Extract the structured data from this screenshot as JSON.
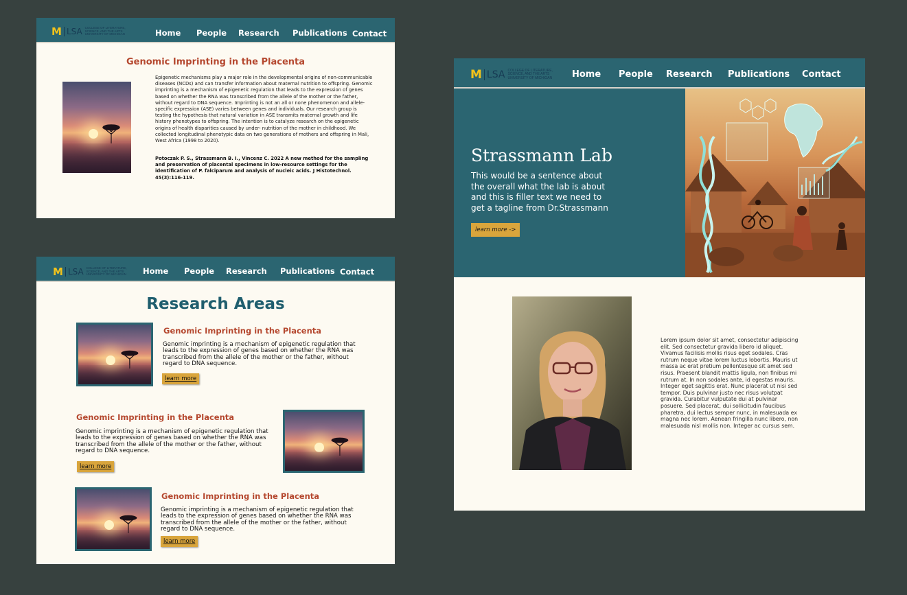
{
  "logo": {
    "mark": "M",
    "lsa": "LSA",
    "line1": "COLLEGE OF LITERATURE,",
    "line2": "SCIENCE, AND THE ARTS",
    "line3": "UNIVERSITY OF MICHIGAN"
  },
  "nav": {
    "home": "Home",
    "people": "People",
    "research": "Research",
    "publications": "Publications",
    "contact": "Contact"
  },
  "detail_page": {
    "title": "Genomic Imprinting in the Placenta",
    "body": "Epigenetic mechanisms play a major role in the developmental origins of non-communicable diseases (NCDs) and can transfer information about maternal nutrition to offspring. Genomic imprinting is a mechanism of epigenetic regulation that leads to the expression of genes based on whether the RNA was transcribed from the allele of the mother or the father, without regard to DNA sequence. Imprinting is not an all or none phenomenon and allele-specific expression (ASE) varies between genes and individuals. Our research group is testing the hypothesis that natural variation in ASE transmits maternal growth and life history phenotypes to offspring. The intention is to catalyze research on the epigenetic origins of health disparities caused by under- nutrition of the mother in childhood. We collected longitudinal phenotypic data on two generations of mothers and offspring in Mali, West Africa (1998 to 2020).",
    "reference": "Potoczak P. S., Strassmann B. I., Vincenz C. 2022 A new method for the sampling and preservation of placental specimens in low-resource settings for the identification of P. falciparum and analysis of nucleic acids. J Histotechnol. 45(3):116-119."
  },
  "areas_page": {
    "title": "Research Areas",
    "cards": [
      {
        "title": "Genomic Imprinting in the Placenta",
        "text": "Genomic imprinting is a mechanism of epigenetic regulation that leads to the expression of genes based on whether the RNA was transcribed from the allele of the mother or the father, without regard to DNA sequence.",
        "button": "learn more"
      },
      {
        "title": "Genomic Imprinting in the Placenta",
        "text": "Genomic imprinting is a mechanism of epigenetic regulation that leads to the expression of genes based on whether the RNA was transcribed from the allele of the mother or the father, without regard to DNA sequence.",
        "button": "learn more"
      },
      {
        "title": "Genomic Imprinting in the Placenta",
        "text": "Genomic imprinting is a mechanism of epigenetic regulation that leads to the expression of genes based on whether the RNA was transcribed from the allele of the mother or the father, without regard to DNA sequence.",
        "button": "learn more"
      }
    ]
  },
  "home_page": {
    "title": "Strassmann Lab",
    "tagline": "This would be a sentence about the overall what the lab is about and this is filler text we need to get a tagline from Dr.Strassmann",
    "button": "learn more ->",
    "bio": "Lorem ipsum dolor sit amet, consectetur adipiscing elit. Sed consectetur gravida libero id aliquet. Vivamus facilisis mollis risus eget sodales. Cras rutrum neque vitae lorem luctus lobortis. Mauris ut massa ac erat pretium pellentesque sit amet sed risus. Praesent blandit mattis ligula, non finibus mi rutrum at. In non sodales ante, id egestas mauris. Integer eget sagittis erat. Nunc placerat ut nisi sed tempor. Duis pulvinar justo nec risus volutpat gravida. Curabitur vulputate dui at pulvinar posuere. Sed placerat, dui sollicitudin faucibus pharetra, dui lectus semper nunc, in malesuada ex magna nec lorem. Aenean fringilla nunc libero, non malesuada nisl mollis non. Integer ac cursus sem."
  },
  "colors": {
    "teal": "#2b6571",
    "maize": "#f2c21b",
    "rust": "#b5482f",
    "button": "#d9a53c",
    "cream": "#fdfaf2",
    "backdrop": "#37413f"
  }
}
